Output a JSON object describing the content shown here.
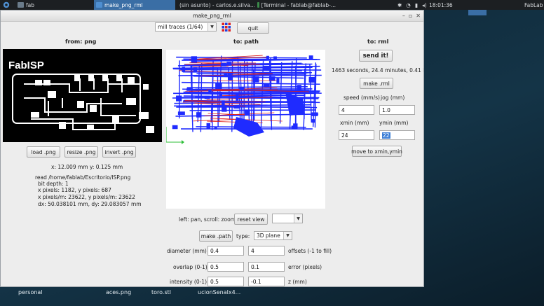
{
  "taskbar": {
    "items": [
      {
        "label": "fab",
        "active": false
      },
      {
        "label": "make_png_rml",
        "active": true
      },
      {
        "label": "(sin asunto) - carlos.e.silva...",
        "active": false
      },
      {
        "label": "[Terminal - fablab@fablab-...",
        "active": false
      }
    ],
    "clock": "18:01:36",
    "right_label": "FabLab"
  },
  "desktop": {
    "icons": [
      "personal",
      "aces.png",
      "toro.stl",
      "ucionSenalx4..."
    ]
  },
  "window": {
    "title": "make_png_rml",
    "mode_select": "mill traces (1/64)",
    "quit_label": "quit",
    "left": {
      "header": "from: png",
      "image_text": "FabISP",
      "load_label": "load .png",
      "resize_label": "resize .png",
      "invert_label": "invert .png",
      "coords": "x: 12.009 mm  y: 0.125 mm",
      "info": [
        "read /home/fablab/Escritorio/ISP.png",
        "bit depth: 1",
        "x pixels: 1182, y pixels: 687",
        "x pixels/m: 23622, y pixels/m: 23622",
        "dx: 50.038101 mm, dy: 29.083057 mm"
      ]
    },
    "center": {
      "header": "to: path",
      "pan_hint": "left: pan, scroll: zoom",
      "reset_view_label": "reset view",
      "reset_select": "",
      "make_path_label": "make .path",
      "type_label": "type:",
      "type_value": "3D plane",
      "params": [
        {
          "label": "diameter (mm)",
          "value": "0.4",
          "value2": "4",
          "label2": "offsets (-1 to fill)"
        },
        {
          "label": "overlap (0-1)",
          "value": "0.5",
          "value2": "0.1",
          "label2": "error (pixels)"
        },
        {
          "label": "intensity (0-1)",
          "value": "0.5",
          "value2": "-0.1",
          "label2": "z (mm)"
        }
      ]
    },
    "right": {
      "header": "to: rml",
      "send_label": "send it!",
      "time_estimate": "1463 seconds, 24.4 minutes, 0.41 hours",
      "make_rml_label": "make .rml",
      "speed_label": "speed (mm/s)",
      "jog_label": "jog (mm)",
      "speed_value": "4",
      "jog_value": "1.0",
      "xmin_label": "xmin (mm)",
      "ymin_label": "ymin (mm)",
      "xmin_value": "24",
      "ymin_value": "22",
      "move_label": "move to xmin,ymin"
    }
  },
  "colors": {
    "toolpath_blue": "#1f2bff",
    "toolpath_red": "#e0201a",
    "origin_green": "#2fbf3a",
    "taskbar_active": "#3a6ea5"
  }
}
